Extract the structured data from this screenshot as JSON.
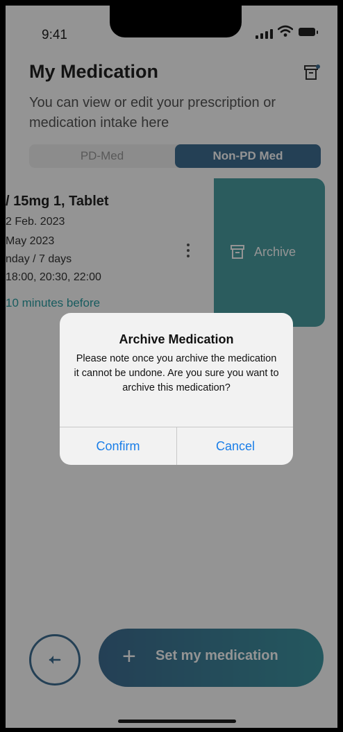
{
  "status_bar": {
    "time": "9:41"
  },
  "header": {
    "title": "My Medication",
    "subtitle": "You can view or edit your prescription or medication intake here"
  },
  "tabs": [
    {
      "label": "PD-Med",
      "active": false
    },
    {
      "label": "Non-PD Med",
      "active": true
    }
  ],
  "medication_card": {
    "name_dose": "/ 15mg 1, Tablet",
    "start_date": "2 Feb. 2023",
    "end_date": "May 2023",
    "frequency": "nday / 7 days",
    "times": "18:00, 20:30, 22:00",
    "reminder": "10 minutes before",
    "swipe_action_label": "Archive"
  },
  "dialog": {
    "title": "Archive Medication",
    "message": "Please note once you archive the medication it cannot be undone. Are you sure you want to archive this medication?",
    "confirm_label": "Confirm",
    "cancel_label": "Cancel"
  },
  "bottom_bar": {
    "set_button_label": "Set my medication",
    "plus_symbol": "+"
  },
  "colors": {
    "primary": "#3e6e93",
    "accent_teal": "#4a9fa3",
    "ios_blue": "#1a7ee8",
    "reminder_text": "#2a9fa4"
  },
  "icons": {
    "archive_top": "archive-box-icon",
    "back": "arrow-left-icon",
    "kebab": "more-vertical-icon"
  }
}
